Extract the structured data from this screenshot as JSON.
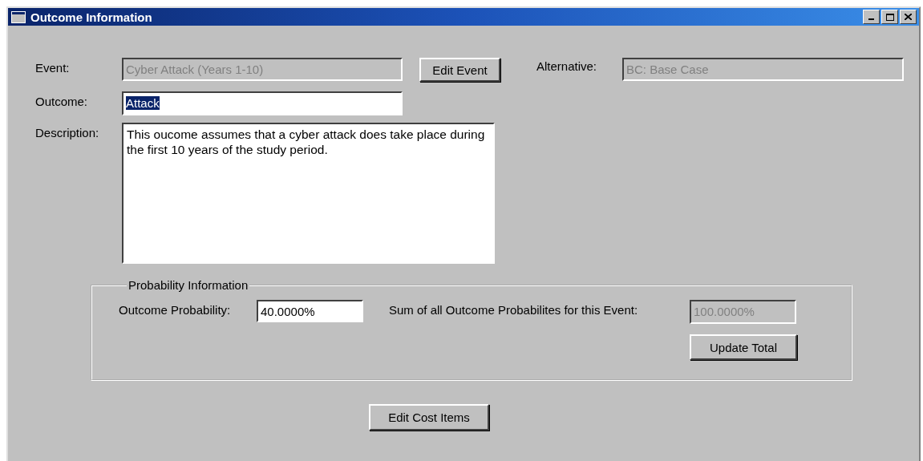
{
  "window": {
    "title": "Outcome Information"
  },
  "event": {
    "label": "Event:",
    "value": "Cyber Attack (Years 1-10)",
    "disabled": true
  },
  "edit_event_button": "Edit Event",
  "alternative": {
    "label": "Alternative:",
    "value": "BC: Base Case",
    "disabled": true
  },
  "outcome": {
    "label": "Outcome:",
    "value": "Attack",
    "disabled": false,
    "text_selected": true
  },
  "description": {
    "label": "Description:",
    "value": "This oucome assumes that a cyber attack does take place during the first 10 years of the study period."
  },
  "probability_group": {
    "title": "Probability Information",
    "outcome_probability": {
      "label": "Outcome Probability:",
      "value": "40.0000%",
      "disabled": false
    },
    "sum": {
      "label": "Sum of all Outcome Probabilites for this Event:",
      "value": "100.0000%",
      "disabled": true
    },
    "update_button": "Update Total"
  },
  "edit_cost_items_button": "Edit Cost Items"
}
